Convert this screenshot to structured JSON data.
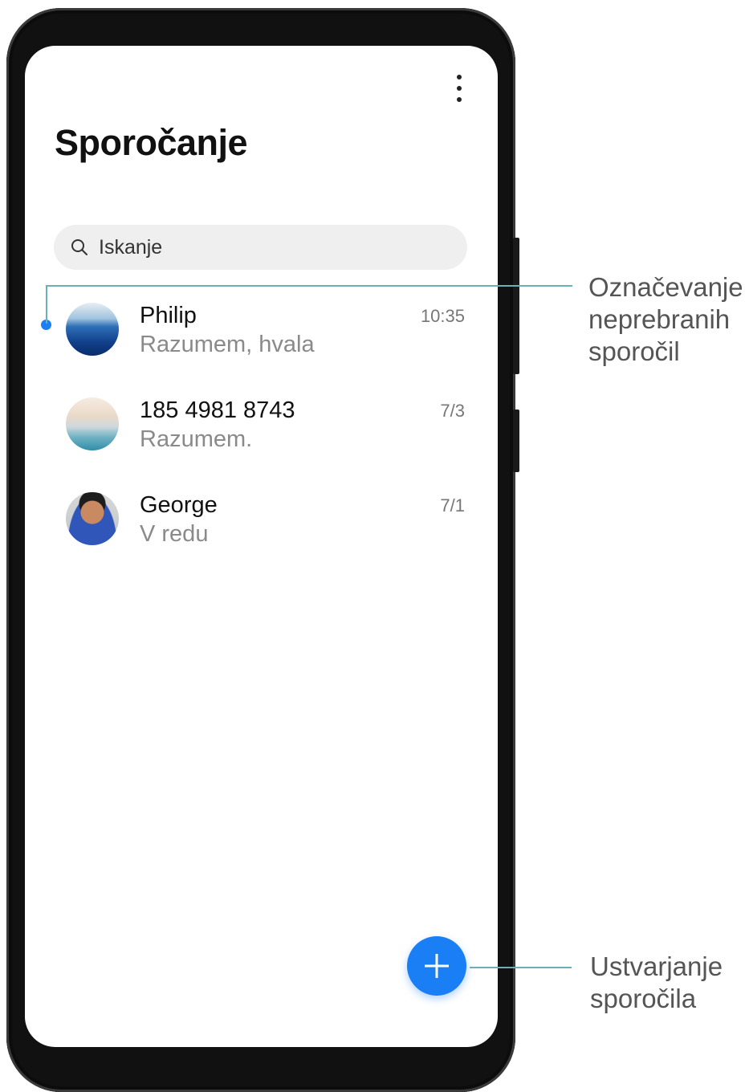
{
  "app": {
    "title": "Sporočanje"
  },
  "search": {
    "placeholder": "Iskanje"
  },
  "conversations": [
    {
      "name": "Philip",
      "preview": "Razumem, hvala",
      "time": "10:35"
    },
    {
      "name": "185 4981 8743",
      "preview": "Razumem.",
      "time": "7/3"
    },
    {
      "name": "George",
      "preview": "V redu",
      "time": "7/1"
    }
  ],
  "icons": {
    "menu": "more-vertical-icon",
    "search": "search-icon",
    "new_message": "plus-icon"
  },
  "colors": {
    "accent": "#1a7ff5",
    "callout_line": "#6ab0b8"
  },
  "callouts": {
    "unread": [
      "Označevanje",
      "neprebranih",
      "sporočil"
    ],
    "compose": [
      "Ustvarjanje",
      "sporočila"
    ]
  }
}
